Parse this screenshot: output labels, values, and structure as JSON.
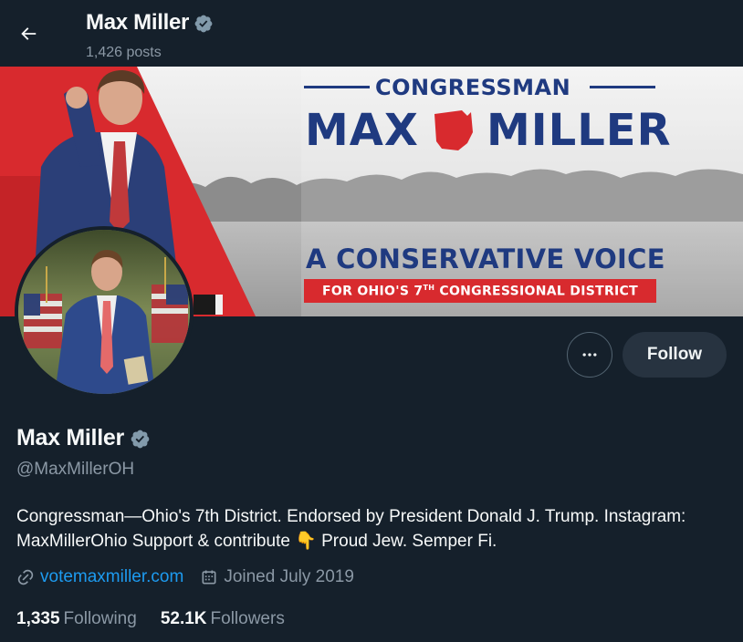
{
  "header": {
    "title": "Max Miller",
    "posts_count": "1,426 posts",
    "back_icon": "arrow-left-icon"
  },
  "banner": {
    "line1": "CONGRESSMAN",
    "name_left": "MAX",
    "name_right": "MILLER",
    "tagline": "A CONSERVATIVE VOICE",
    "district_prefix": "FOR OHIO'S 7",
    "district_sup": "TH",
    "district_suffix": " CONGRESSIONAL DISTRICT",
    "colors": {
      "navy": "#1f3a80",
      "red": "#d82a2e"
    }
  },
  "actions": {
    "more_icon": "more-horizontal-icon",
    "follow_label": "Follow"
  },
  "profile": {
    "display_name": "Max Miller",
    "handle": "@MaxMillerOH",
    "bio_line1": "Congressman—Ohio's 7th District. Endorsed by President Donald J. Trump. Instagram:",
    "bio_line2_a": "MaxMillerOhio Support & contribute ",
    "bio_emoji": "👇",
    "bio_line2_b": " Proud Jew. Semper Fi.",
    "website": "votemaxmiller.com",
    "joined": "Joined July 2019"
  },
  "stats": {
    "following_count": "1,335",
    "following_label": "Following",
    "followers_count": "52.1K",
    "followers_label": "Followers"
  },
  "theme": {
    "background": "#15202b",
    "text": "#f7f9f9",
    "muted": "#8b98a5",
    "link": "#1d9bf0",
    "verified_badge": "#829aab"
  }
}
